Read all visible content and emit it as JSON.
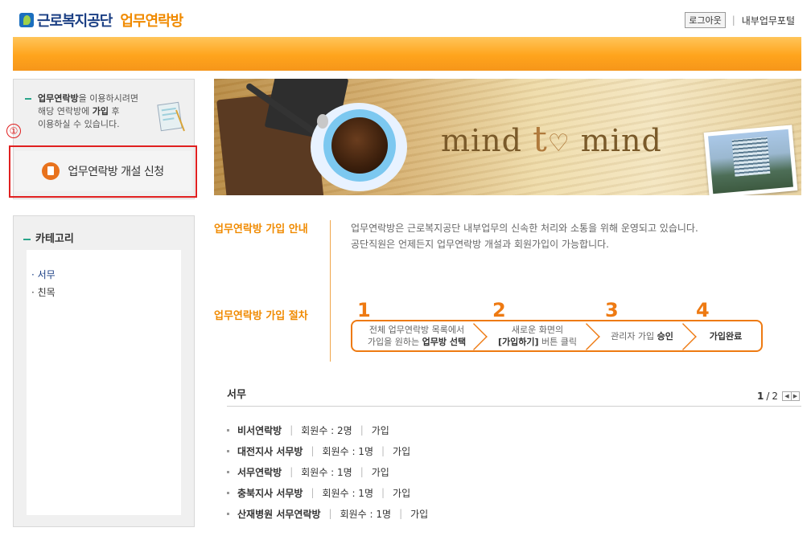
{
  "header": {
    "org_name": "근로복지공단",
    "site_name": "업무연락방",
    "logout_label": "로그아웃",
    "portal_label": "내부업무포털"
  },
  "join_box": {
    "line1_bold": "업무연락방",
    "line1_rest": "을 이용하시려면",
    "line2_pre": "해당 연락방에 ",
    "line2_bold": "가입",
    "line2_post": " 후",
    "line3": "이용하실 수 있습니다.",
    "marker": "①",
    "open_button_label": "업무연락방 개설 신청"
  },
  "category": {
    "title": "카테고리",
    "items": [
      "서무",
      "친목"
    ]
  },
  "banner": {
    "word1": "mind",
    "word2": "t",
    "word3": "mind"
  },
  "info": {
    "guide_label": "업무연락방 가입 안내",
    "guide_line1": "업무연락방은 근로복지공단 내부업무의 신속한 처리와 소통을 위해 운영되고 있습니다.",
    "guide_line2": "공단직원은 언제든지 업무연락방 개설과 회원가입이 가능합니다.",
    "procedure_label": "업무연락방 가입 절차",
    "steps": [
      {
        "num": "1",
        "line1": "전체 업무연락방 목록에서",
        "line2_pre": "가입을 원하는 ",
        "line2_bold": "업무방 선택"
      },
      {
        "num": "2",
        "line1": "새로운 화면의",
        "line2_bold": "[가입하기]",
        "line2_post": " 버튼 클릭"
      },
      {
        "num": "3",
        "line1_pre": "관리자 가입 ",
        "line1_bold": "승인"
      },
      {
        "num": "4",
        "line1": "가입완료"
      }
    ]
  },
  "list": {
    "title": "서무",
    "page_current": "1",
    "page_sep": "/",
    "page_total": "2",
    "prev_icon": "◀",
    "next_icon": "▶",
    "rooms": [
      {
        "name": "비서연락방",
        "members": "회원수 : 2명",
        "join": "가입"
      },
      {
        "name": "대전지사 서무방",
        "members": "회원수 : 1명",
        "join": "가입"
      },
      {
        "name": "서무연락방",
        "members": "회원수 : 1명",
        "join": "가입"
      },
      {
        "name": "충북지사 서무방",
        "members": "회원수 : 1명",
        "join": "가입"
      },
      {
        "name": "산재병원 서무연락방",
        "members": "회원수 : 1명",
        "join": "가입"
      }
    ]
  },
  "colors": {
    "accent_orange": "#f08a00",
    "brand_navy": "#1b3f84",
    "highlight_red": "#e02020",
    "band_orange": "#ffa41c"
  }
}
